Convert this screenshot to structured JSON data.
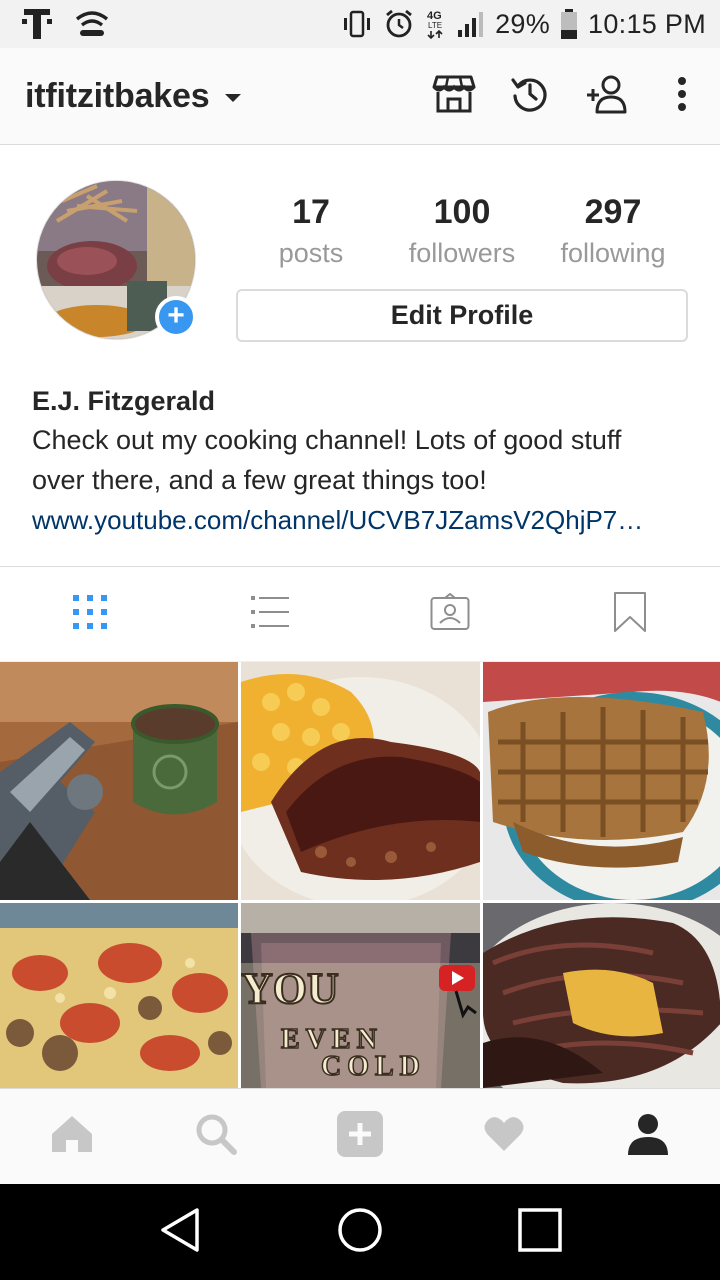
{
  "status_bar": {
    "carrier_icon": "t-mobile-icon",
    "battery": "29%",
    "time": "10:15 PM",
    "network": "4G LTE"
  },
  "header": {
    "username": "itfitzitbakes",
    "actions": [
      "shop-icon",
      "archive-history-icon",
      "discover-people-icon",
      "overflow-menu-icon"
    ]
  },
  "profile": {
    "stats": [
      {
        "count": "17",
        "label": "posts"
      },
      {
        "count": "100",
        "label": "followers"
      },
      {
        "count": "297",
        "label": "following"
      }
    ],
    "edit_label": "Edit Profile",
    "full_name": "E.J. Fitzgerald",
    "bio_line1": "Check out my cooking channel! Lots of good stuff",
    "bio_line2": "over there, and a few great things too!",
    "link": "www.youtube.com/channel/UCVB7JZamsV2QhjP7…"
  },
  "tabs": [
    "grid-view",
    "list-view",
    "tagged-photos",
    "saved-posts"
  ],
  "overlay_text": {
    "line1": "YOU",
    "line2": "EVEN",
    "line3": "COLD"
  },
  "colors": {
    "accent": "#3897f0",
    "link": "#003569",
    "muted": "#999999"
  }
}
